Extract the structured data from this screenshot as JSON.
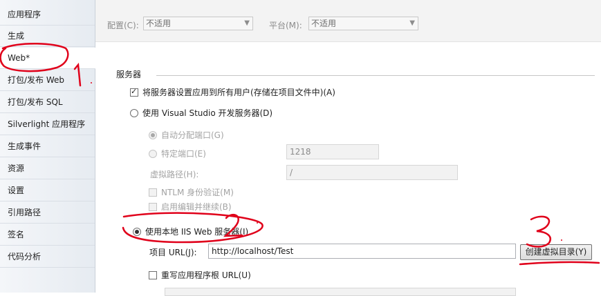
{
  "sidebar": {
    "items": [
      {
        "label": "应用程序"
      },
      {
        "label": "生成"
      },
      {
        "label": "Web*"
      },
      {
        "label": "打包/发布 Web"
      },
      {
        "label": "打包/发布 SQL"
      },
      {
        "label": "Silverlight 应用程序"
      },
      {
        "label": "生成事件"
      },
      {
        "label": "资源"
      },
      {
        "label": "设置"
      },
      {
        "label": "引用路径"
      },
      {
        "label": "签名"
      },
      {
        "label": "代码分析"
      }
    ],
    "active_index": 2
  },
  "topbar": {
    "config_label": "配置(C):",
    "config_value": "不适用",
    "platform_label": "平台(M):",
    "platform_value": "不适用"
  },
  "servers": {
    "group_title": "服务器",
    "apply_all_users": {
      "label": "将服务器设置应用到所有用户(存储在项目文件中)(A)",
      "checked": true
    },
    "vs_dev_server": {
      "label": "使用 Visual Studio 开发服务器(D)",
      "checked": false
    },
    "auto_port": {
      "label": "自动分配端口(G)",
      "checked": true
    },
    "specific_port": {
      "label": "特定端口(E)",
      "value": "1218"
    },
    "virtual_path": {
      "label": "虚拟路径(H):",
      "value": "/"
    },
    "ntlm_auth": {
      "label": "NTLM 身份验证(M)"
    },
    "edit_continue": {
      "label": "启用编辑并继续(B)"
    },
    "local_iis": {
      "label": "使用本地 IIS Web 服务器(I)",
      "checked": true
    },
    "project_url": {
      "label": "项目 URL(J):",
      "value": "http://localhost/Test"
    },
    "create_vdir_button": "创建虚拟目录(Y)",
    "override_root_url": {
      "label": "重写应用程序根 URL(U)"
    }
  },
  "annotations": {
    "marks": [
      "1",
      "2",
      "3"
    ],
    "color": "#e0001a"
  },
  "colors": {
    "sidebar_bg": "#e6ebf1",
    "topbar_bg": "#f3f3f3",
    "annotation_red": "#e0001a"
  }
}
